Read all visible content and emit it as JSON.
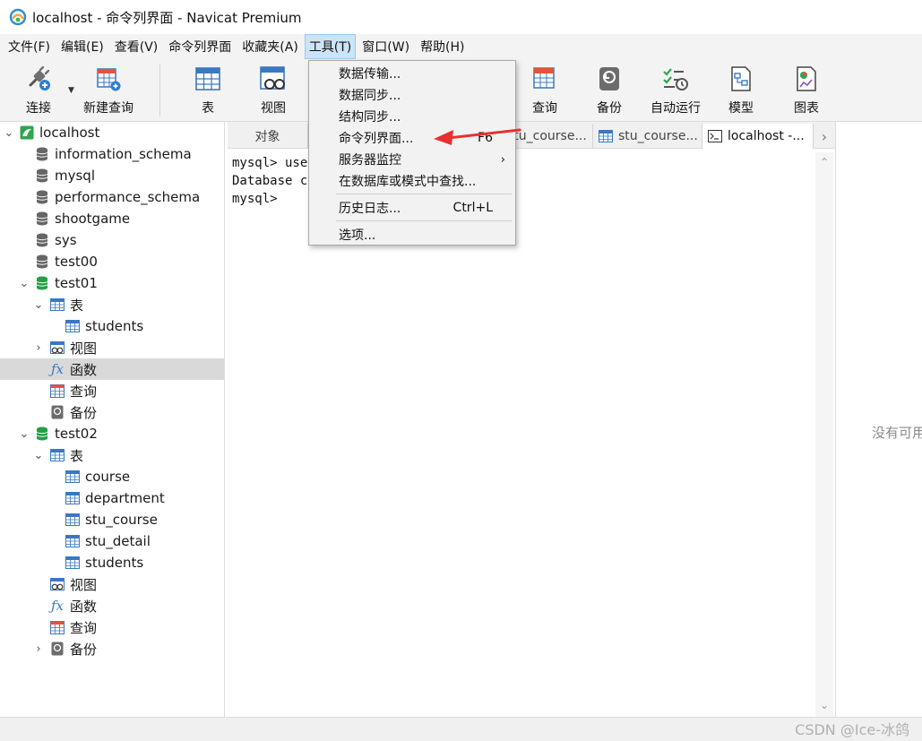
{
  "window": {
    "title": "localhost - 命令列界面 - Navicat Premium"
  },
  "menubar": {
    "items": [
      {
        "label": "文件(F)",
        "active": false
      },
      {
        "label": "编辑(E)",
        "active": false
      },
      {
        "label": "查看(V)",
        "active": false
      },
      {
        "label": "命令列界面",
        "active": false
      },
      {
        "label": "收藏夹(A)",
        "active": false
      },
      {
        "label": "工具(T)",
        "active": true
      },
      {
        "label": "窗口(W)",
        "active": false
      },
      {
        "label": "帮助(H)",
        "active": false
      }
    ]
  },
  "toolbar": {
    "connect": "连接",
    "new_query": "新建查询",
    "table": "表",
    "view": "视图",
    "query": "查询",
    "backup": "备份",
    "automation": "自动运行",
    "model": "模型",
    "chart": "图表"
  },
  "sidebar": {
    "items": [
      {
        "label": "localhost"
      },
      {
        "label": "information_schema"
      },
      {
        "label": "mysql"
      },
      {
        "label": "performance_schema"
      },
      {
        "label": "shootgame"
      },
      {
        "label": "sys"
      },
      {
        "label": "test00"
      },
      {
        "label": "test01"
      },
      {
        "label": "表"
      },
      {
        "label": "students"
      },
      {
        "label": "视图"
      },
      {
        "label": "函数"
      },
      {
        "label": "查询"
      },
      {
        "label": "备份"
      },
      {
        "label": "test02"
      },
      {
        "label": "表"
      },
      {
        "label": "course"
      },
      {
        "label": "department"
      },
      {
        "label": "stu_course"
      },
      {
        "label": "stu_detail"
      },
      {
        "label": "students"
      },
      {
        "label": "视图"
      },
      {
        "label": "函数"
      },
      {
        "label": "查询"
      },
      {
        "label": "备份"
      }
    ]
  },
  "tabs": [
    {
      "label": "对象"
    },
    {
      "label": "stu_course..."
    },
    {
      "label": "stu_course..."
    },
    {
      "label": "localhost -..."
    }
  ],
  "console": {
    "lines": [
      "mysql> use",
      "Database c",
      "mysql>"
    ]
  },
  "dropdown": {
    "items": [
      {
        "label": "数据传输..."
      },
      {
        "label": "数据同步..."
      },
      {
        "label": "结构同步..."
      },
      {
        "label": "命令列界面...",
        "shortcut": "F6"
      },
      {
        "label": "服务器监控"
      },
      {
        "label": "在数据库或模式中查找..."
      },
      {
        "label": "历史日志...",
        "shortcut": "Ctrl+L"
      },
      {
        "label": "选项..."
      }
    ]
  },
  "right_panel": {
    "message": "没有可用"
  },
  "watermark": "CSDN @Ice-冰鸽",
  "colors": {
    "accent": "#cce4f7",
    "db_green": "#22a045",
    "table_blue": "#3a78c2",
    "arrow_red": "#e8312f"
  }
}
